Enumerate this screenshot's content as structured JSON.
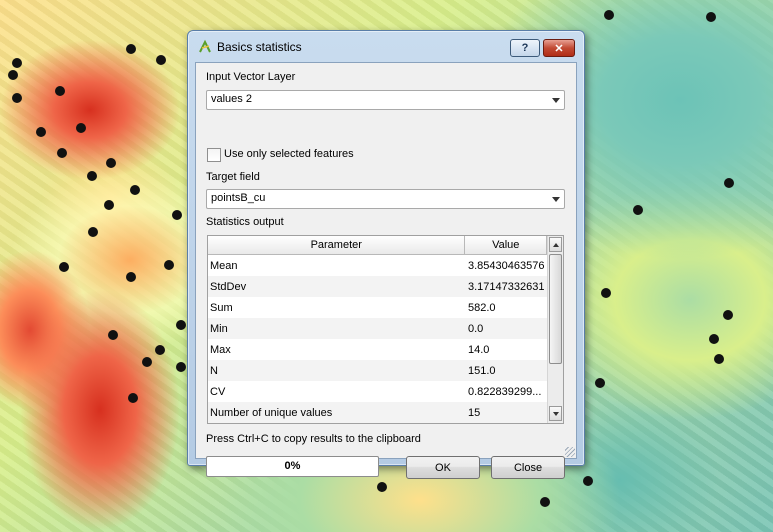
{
  "window": {
    "title": "Basics statistics",
    "help_label": "?",
    "close_label": "✕"
  },
  "form": {
    "input_layer_label": "Input Vector Layer",
    "input_layer_value": "values 2",
    "use_selected_label": "Use only selected features",
    "use_selected_checked": false,
    "target_field_label": "Target field",
    "target_field_value": "pointsB_cu",
    "statistics_output_label": "Statistics output"
  },
  "table": {
    "headers": [
      "Parameter",
      "Value"
    ],
    "rows": [
      {
        "parameter": "Mean",
        "value": "3.85430463576"
      },
      {
        "parameter": "StdDev",
        "value": "3.17147332631"
      },
      {
        "parameter": "Sum",
        "value": "582.0"
      },
      {
        "parameter": "Min",
        "value": "0.0"
      },
      {
        "parameter": "Max",
        "value": "14.0"
      },
      {
        "parameter": "N",
        "value": "151.0"
      },
      {
        "parameter": "CV",
        "value": "0.822839299..."
      },
      {
        "parameter": "Number of unique values",
        "value": "15"
      }
    ]
  },
  "footer": {
    "hint": "Press Ctrl+C to copy results to the clipboard",
    "progress_percent": 0,
    "progress_text": "0%",
    "ok_label": "OK",
    "close_label": "Close"
  },
  "colors": {
    "progress_fill": "#2a7ed6",
    "dialog_bg": "#f0f0f0",
    "titlebar": "#b4cbe4",
    "close_button": "#c24a34"
  }
}
